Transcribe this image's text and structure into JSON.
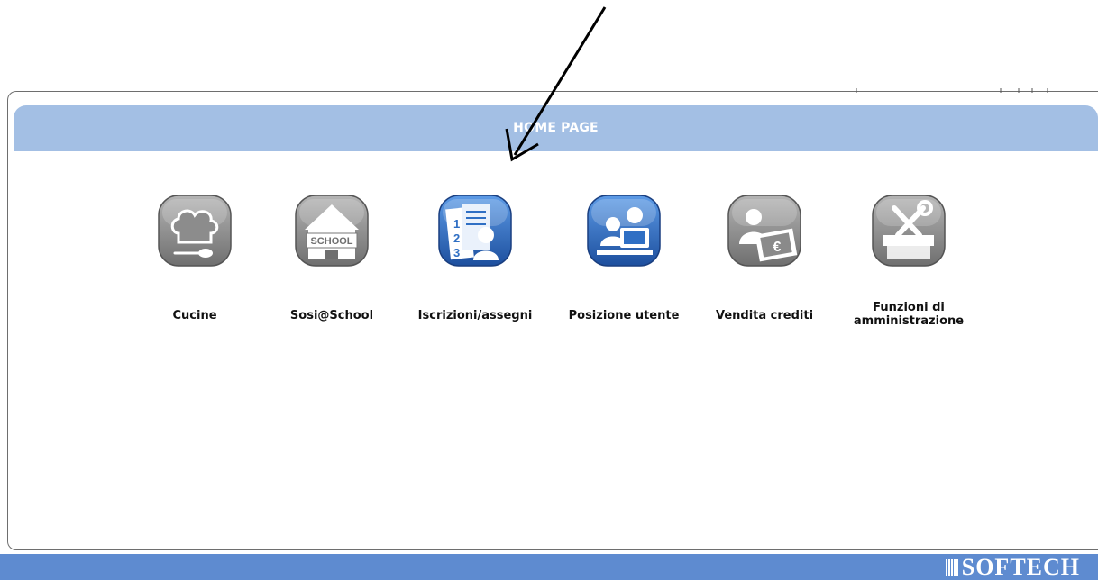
{
  "header": {
    "title": "HOME PAGE"
  },
  "tiles": [
    {
      "label": "Cucine",
      "icon": "chef-hat-icon",
      "style": "gray"
    },
    {
      "label": "Sosi@School",
      "icon": "school-icon",
      "style": "gray",
      "icon_text": "SCHOOL"
    },
    {
      "label": "Iscrizioni/assegni",
      "icon": "registration-list-icon",
      "style": "blue",
      "icon_text": [
        "1",
        "2",
        "3"
      ]
    },
    {
      "label": "Posizione utente",
      "icon": "user-position-icon",
      "style": "blue"
    },
    {
      "label": "Vendita crediti",
      "icon": "sell-credits-icon",
      "style": "gray",
      "icon_text": "€"
    },
    {
      "label": "Funzioni di\namministrazione",
      "icon": "admin-tools-icon",
      "style": "gray"
    }
  ],
  "footer": {
    "brand": "SOFTECH"
  },
  "colors": {
    "header_bar": "#a3bfe4",
    "footer_bar": "#5e8bd0",
    "icon_gray": "#8a8a8a",
    "icon_blue": "#2f6fc4"
  }
}
